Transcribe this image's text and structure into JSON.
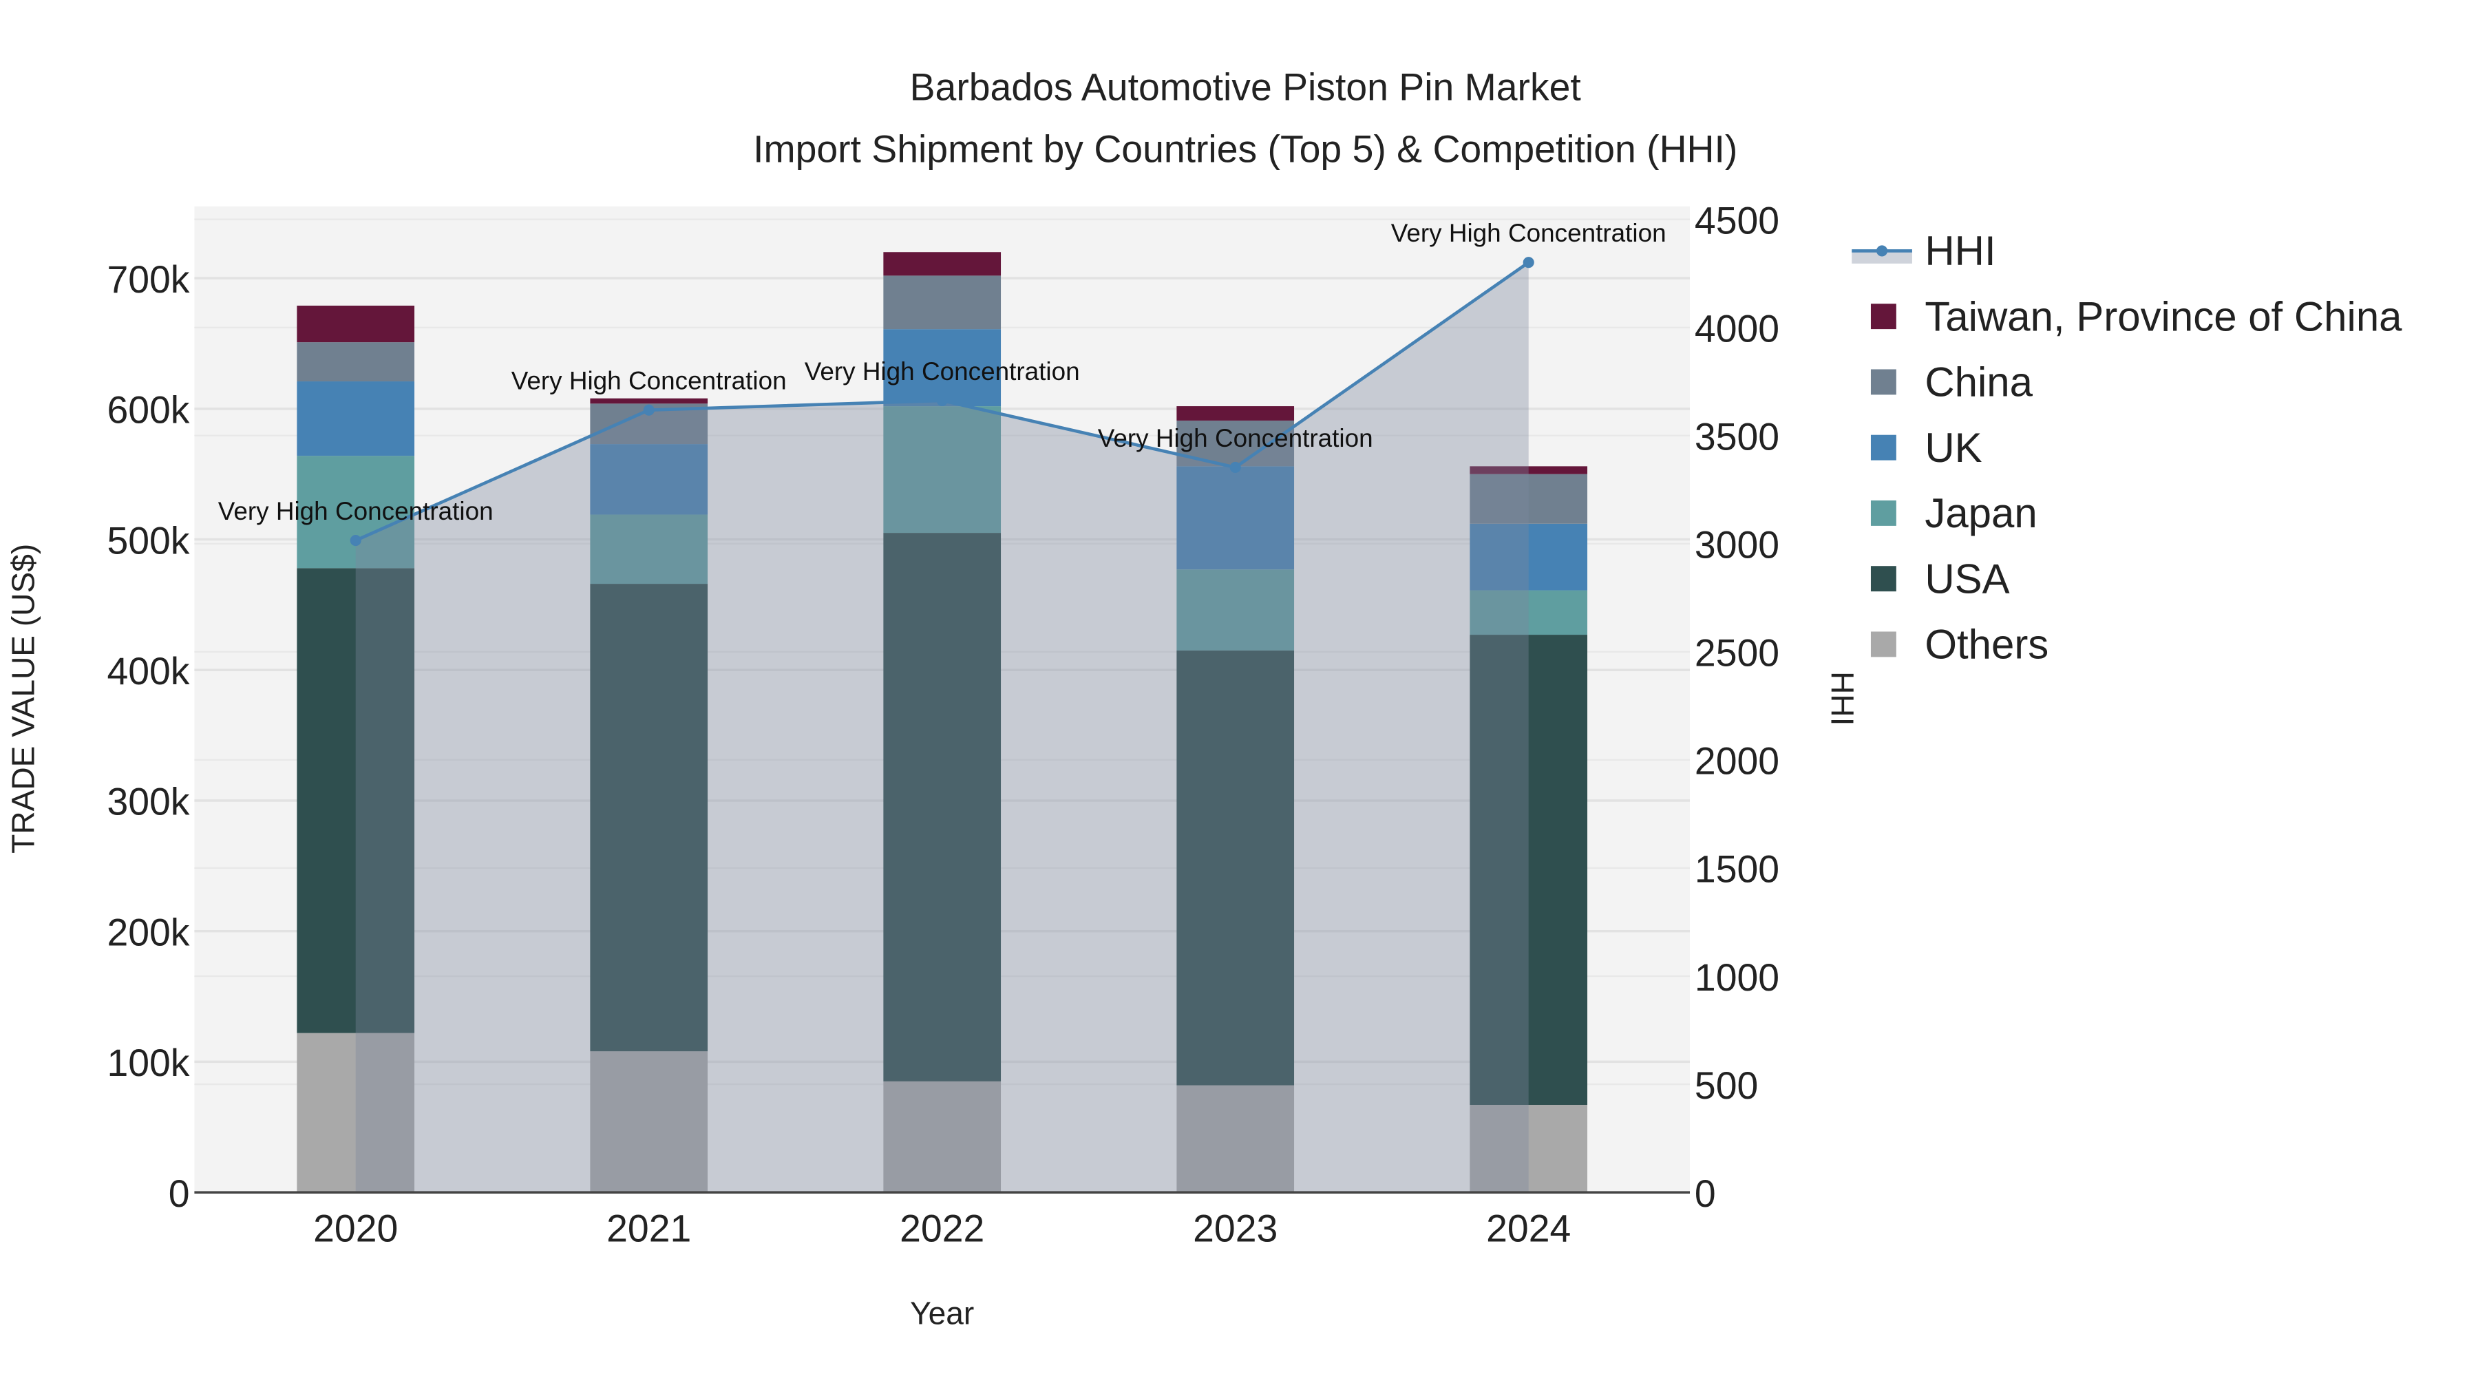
{
  "chart_data": {
    "type": "bar",
    "stacked": true,
    "title": "Barbados Automotive Piston Pin Market",
    "subtitle": "Import Shipment by Countries (Top 5) & Competition (HHI)",
    "xlabel": "Year",
    "ylabel": "TRADE VALUE (US$)",
    "y2label": "HHI",
    "categories": [
      "2020",
      "2021",
      "2022",
      "2023",
      "2024"
    ],
    "ylim": [
      0,
      755000
    ],
    "y_ticks": [
      0,
      100000,
      200000,
      300000,
      400000,
      500000,
      600000,
      700000
    ],
    "y_tick_labels": [
      "0",
      "100k",
      "200k",
      "300k",
      "400k",
      "500k",
      "600k",
      "700k"
    ],
    "y2lim": [
      0,
      4560
    ],
    "y2_ticks": [
      0,
      500,
      1000,
      1500,
      2000,
      2500,
      3000,
      3500,
      4000,
      4500
    ],
    "y2_tick_labels": [
      "0",
      "500",
      "1000",
      "1500",
      "2000",
      "2500",
      "3000",
      "3500",
      "4000",
      "4500"
    ],
    "series": [
      {
        "name": "Others",
        "color": "#a9a9a9",
        "values": [
          122000,
          108000,
          85000,
          82000,
          67000
        ]
      },
      {
        "name": "USA",
        "color": "#2f4f4f",
        "values": [
          356000,
          358000,
          420000,
          333000,
          360000
        ]
      },
      {
        "name": "Japan",
        "color": "#5f9ea0",
        "values": [
          86000,
          53000,
          97000,
          62000,
          34000
        ]
      },
      {
        "name": "UK",
        "color": "#4682b4",
        "values": [
          57000,
          54000,
          59000,
          79000,
          51000
        ]
      },
      {
        "name": "China",
        "color": "#708090",
        "values": [
          30000,
          31000,
          41000,
          35000,
          38000
        ]
      },
      {
        "name": "Taiwan, Province of China",
        "color": "#64163a",
        "values": [
          28000,
          4000,
          18000,
          11000,
          6000
        ]
      }
    ],
    "hhi": {
      "name": "HHI",
      "color": "#4682b4",
      "values": [
        3015,
        3618,
        3662,
        3353,
        4301
      ],
      "annotations": [
        "Very High Concentration",
        "Very High Concentration",
        "Very High Concentration",
        "Very High Concentration",
        "Very High Concentration"
      ]
    },
    "legend": [
      "HHI",
      "Taiwan, Province of China",
      "China",
      "UK",
      "Japan",
      "USA",
      "Others"
    ],
    "legend_position": "right",
    "grid": true
  }
}
